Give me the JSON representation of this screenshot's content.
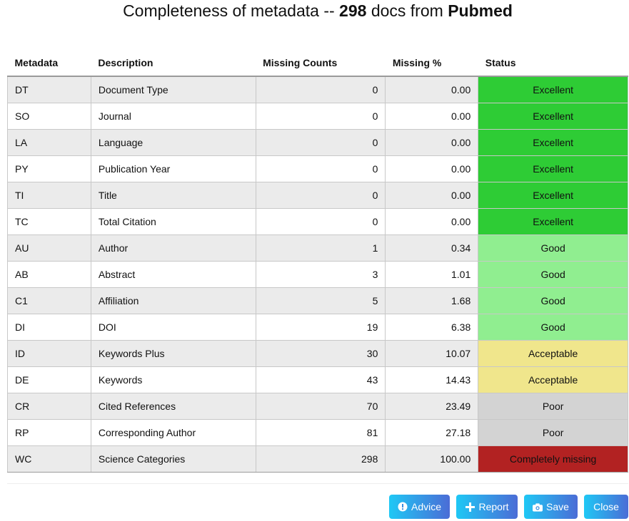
{
  "title": {
    "prefix": "Completeness of metadata --",
    "count": "298",
    "middle": "docs from",
    "source": "Pubmed"
  },
  "columns": [
    "Metadata",
    "Description",
    "Missing Counts",
    "Missing %",
    "Status"
  ],
  "status_colors": {
    "Excellent": "#2ecc35",
    "Good": "#90ee90",
    "Acceptable": "#f0e68c",
    "Poor": "#d3d3d3",
    "Completely missing": "#b22222"
  },
  "rows": [
    {
      "tag": "DT",
      "description": "Document Type",
      "missing": "0",
      "pct": "0.00",
      "status": "Excellent"
    },
    {
      "tag": "SO",
      "description": "Journal",
      "missing": "0",
      "pct": "0.00",
      "status": "Excellent"
    },
    {
      "tag": "LA",
      "description": "Language",
      "missing": "0",
      "pct": "0.00",
      "status": "Excellent"
    },
    {
      "tag": "PY",
      "description": "Publication Year",
      "missing": "0",
      "pct": "0.00",
      "status": "Excellent"
    },
    {
      "tag": "TI",
      "description": "Title",
      "missing": "0",
      "pct": "0.00",
      "status": "Excellent"
    },
    {
      "tag": "TC",
      "description": "Total Citation",
      "missing": "0",
      "pct": "0.00",
      "status": "Excellent"
    },
    {
      "tag": "AU",
      "description": "Author",
      "missing": "1",
      "pct": "0.34",
      "status": "Good"
    },
    {
      "tag": "AB",
      "description": "Abstract",
      "missing": "3",
      "pct": "1.01",
      "status": "Good"
    },
    {
      "tag": "C1",
      "description": "Affiliation",
      "missing": "5",
      "pct": "1.68",
      "status": "Good"
    },
    {
      "tag": "DI",
      "description": "DOI",
      "missing": "19",
      "pct": "6.38",
      "status": "Good"
    },
    {
      "tag": "ID",
      "description": "Keywords Plus",
      "missing": "30",
      "pct": "10.07",
      "status": "Acceptable"
    },
    {
      "tag": "DE",
      "description": "Keywords",
      "missing": "43",
      "pct": "14.43",
      "status": "Acceptable"
    },
    {
      "tag": "CR",
      "description": "Cited References",
      "missing": "70",
      "pct": "23.49",
      "status": "Poor"
    },
    {
      "tag": "RP",
      "description": "Corresponding Author",
      "missing": "81",
      "pct": "27.18",
      "status": "Poor"
    },
    {
      "tag": "WC",
      "description": "Science Categories",
      "missing": "298",
      "pct": "100.00",
      "status": "Completely missing"
    }
  ],
  "buttons": {
    "advice": {
      "label": "Advice",
      "icon": "exclamation-circle-icon"
    },
    "report": {
      "label": "Report",
      "icon": "plus-icon"
    },
    "save": {
      "label": "Save",
      "icon": "camera-icon"
    },
    "close": {
      "label": "Close"
    }
  }
}
